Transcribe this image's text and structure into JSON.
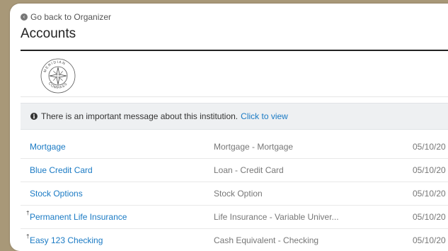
{
  "header": {
    "back_label": "Go back to Organizer",
    "title": "Accounts"
  },
  "logo": {
    "icon": "meridian-compass-logo",
    "text": "MERIDIAN COMPASS"
  },
  "alert": {
    "message": "There is an important message about this institution.",
    "link": "Click to view"
  },
  "accounts": [
    {
      "name": "Mortgage",
      "type": "Mortgage - Mortgage",
      "date": "05/10/20",
      "dagger": ""
    },
    {
      "name": "Blue Credit Card",
      "type": "Loan - Credit Card",
      "date": "05/10/20",
      "dagger": ""
    },
    {
      "name": "Stock Options",
      "type": "Stock Option",
      "date": "05/10/20",
      "dagger": ""
    },
    {
      "name": "Permanent Life Insurance",
      "type": "Life Insurance - Variable Univer...",
      "date": "05/10/20",
      "dagger": "†"
    },
    {
      "name": "Easy 123 Checking",
      "type": "Cash Equivalent - Checking",
      "date": "05/10/20",
      "dagger": "†"
    }
  ],
  "colors": {
    "background": "#a89878",
    "link": "#1a7ac4",
    "alert_bg": "#eef0f2"
  }
}
